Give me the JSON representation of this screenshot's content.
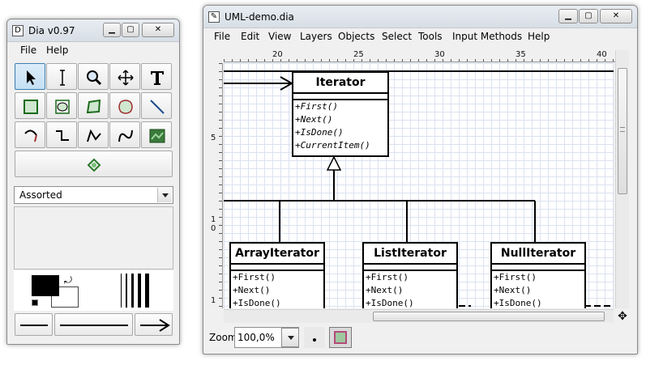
{
  "toolbox": {
    "title": "Dia v0.97",
    "menu": [
      "File",
      "Help"
    ],
    "sheet": "Assorted"
  },
  "diagram": {
    "title": "UML-demo.dia",
    "menu": [
      "File",
      "Edit",
      "View",
      "Layers",
      "Objects",
      "Select",
      "Tools",
      "Input Methods",
      "Help"
    ],
    "ruler_h": [
      "20",
      "25",
      "30",
      "35",
      "40"
    ],
    "ruler_v": [
      "5",
      "1",
      "0",
      "1"
    ],
    "zoom": "100,0%",
    "zoom_label": "Zoom",
    "classes": [
      {
        "name": "Iterator",
        "ops": [
          "+First()",
          "+Next()",
          "+IsDone()",
          "+CurrentItem()"
        ]
      },
      {
        "name": "ArrayIterator",
        "ops": [
          "+First()",
          "+Next()",
          "+IsDone()"
        ]
      },
      {
        "name": "ListIterator",
        "ops": [
          "+First()",
          "+Next()",
          "+IsDone()"
        ]
      },
      {
        "name": "NullIterator",
        "ops": [
          "+First()",
          "+Next()",
          "+IsDone()"
        ]
      }
    ]
  },
  "colors": {
    "foreground": "#000000",
    "background": "#ffffff",
    "grid": "#dbe2f0",
    "selection": "#7a54d6"
  }
}
